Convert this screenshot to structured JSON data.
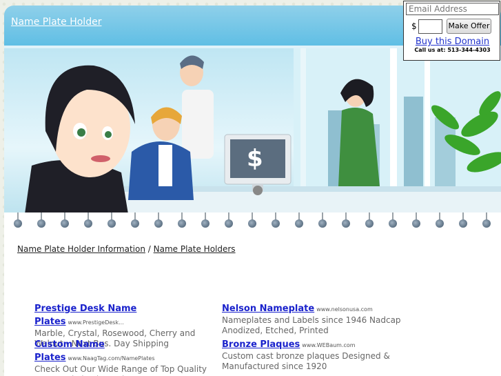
{
  "header": {
    "title": "Name Plate Holder"
  },
  "offer": {
    "email_placeholder": "Email Address",
    "currency": "$",
    "amount_value": "",
    "button_label": "Make Offer",
    "buy_link": "Buy this Domain",
    "call_text": "Call us at: 513-344-4303"
  },
  "hero": {
    "monitor_symbol": "$"
  },
  "breadcrumb": {
    "parent": "Name Plate Holder Information",
    "separator": " / ",
    "current": "Name Plate Holders"
  },
  "ads": [
    {
      "title": "Prestige Desk Name Plates",
      "url": "www.PrestigeDesk...",
      "desc": "Marble, Crystal, Rosewood, Cherry and Walnut - Next Bus. Day Shipping"
    },
    {
      "title": "Nelson Nameplate",
      "url": "www.nelsonusa.com",
      "desc": "Nameplates and Labels since 1946 Nadcap Anodized, Etched, Printed"
    },
    {
      "title": "Custom Name Plates",
      "url": "www.NaagTag.com/NamePlates",
      "desc": "Check Out Our Wide Range of Top Quality Engraved Plastic Products."
    },
    {
      "title": "Bronze Plaques",
      "url": "www.WEBaum.com",
      "desc": "Custom cast bronze plaques Designed & Manufactured since 1920"
    }
  ],
  "colors": {
    "header": "#5cbde4",
    "link": "#1a22cc",
    "ad_desc": "#666666"
  }
}
